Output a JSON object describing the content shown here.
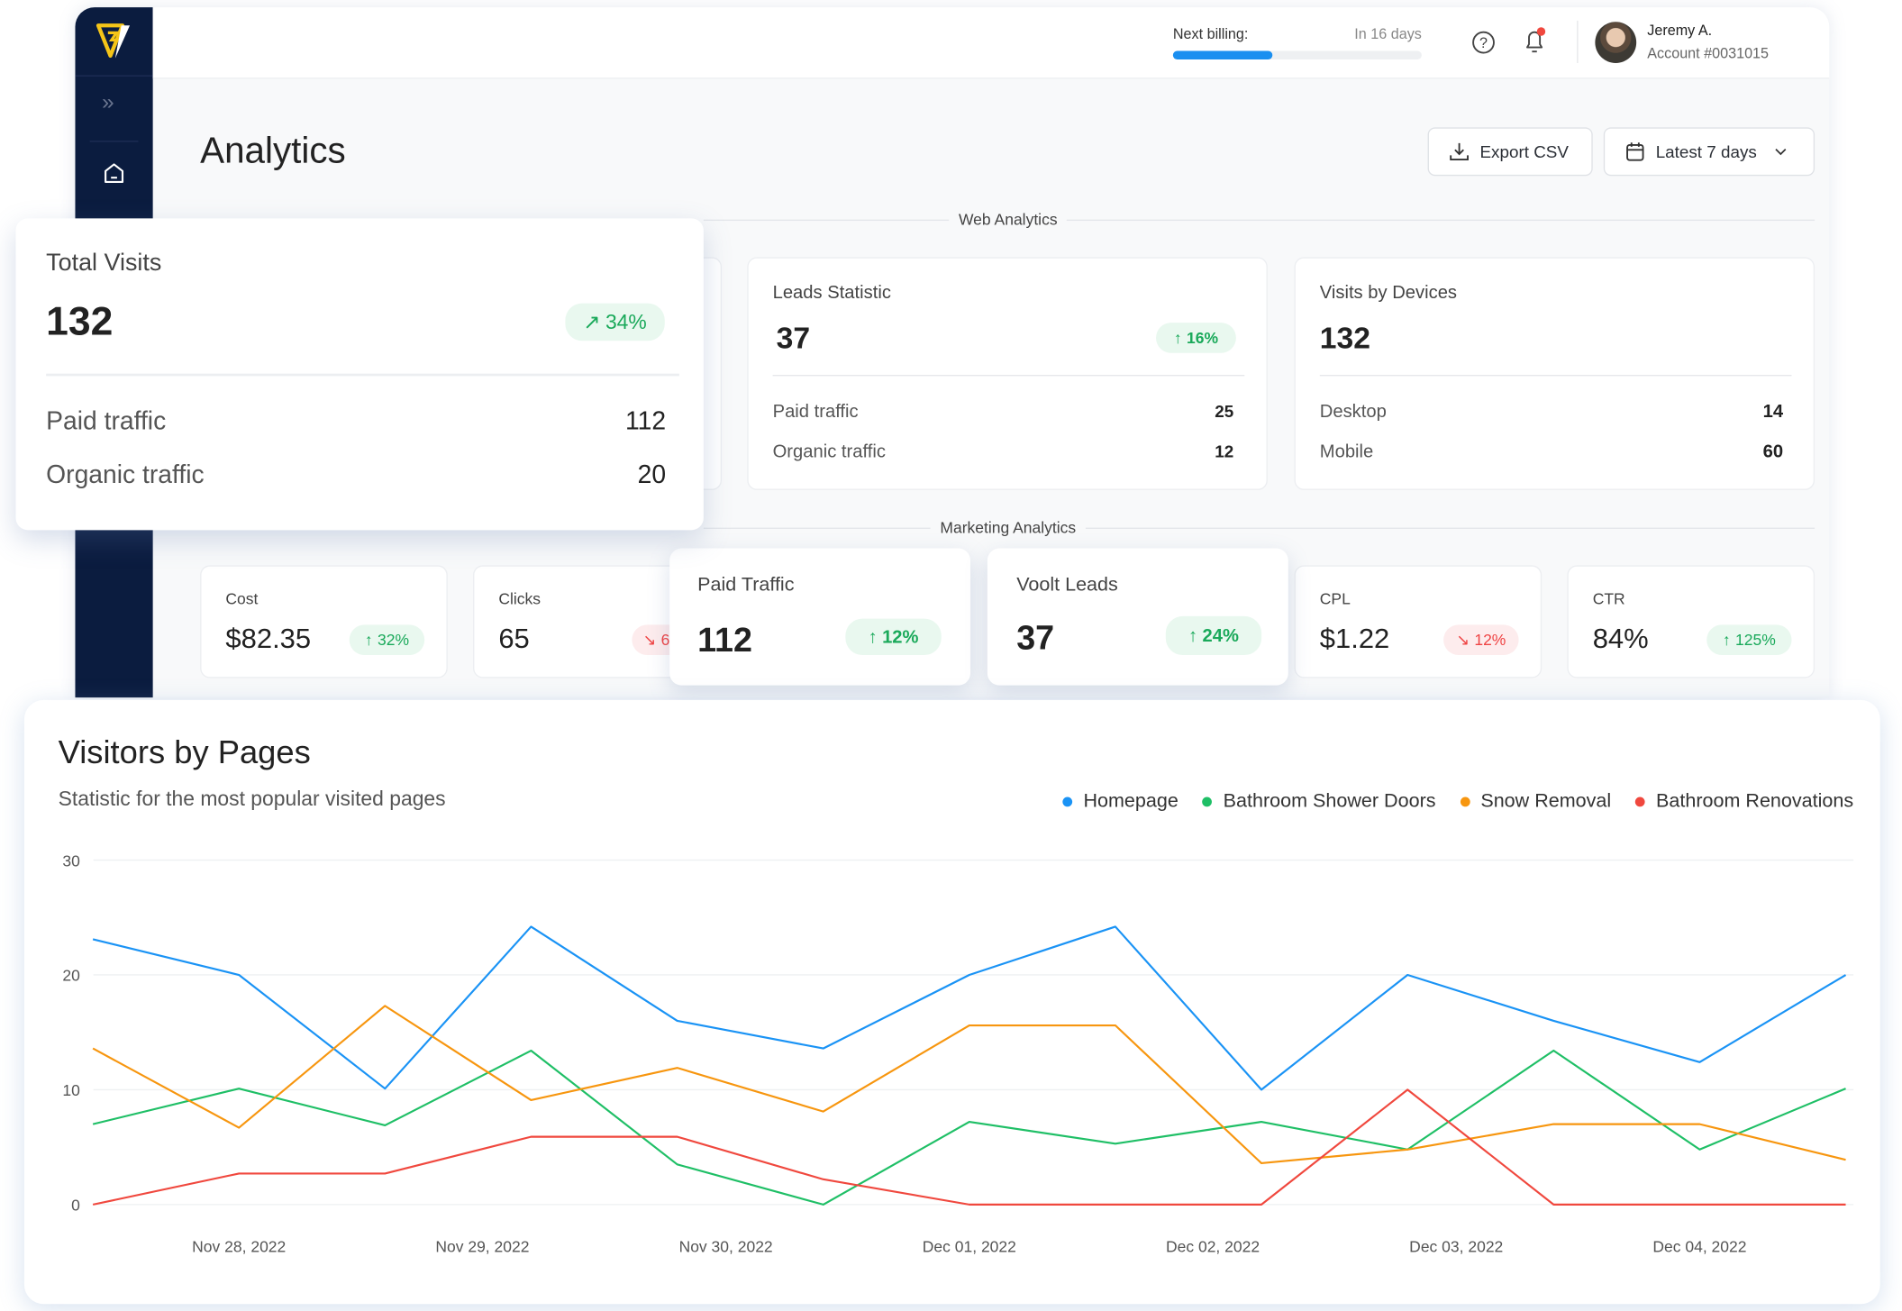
{
  "header": {
    "billing_label": "Next billing:",
    "billing_due": "In 16 days",
    "billing_progress": 0.4,
    "user_name": "Jeremy A.",
    "account": "Account #0031015",
    "notification_dot": true
  },
  "sidebar": {
    "items": [
      {
        "icon": "expand-chevrons-icon"
      },
      {
        "icon": "home-icon"
      }
    ]
  },
  "page": {
    "title": "Analytics",
    "export_label": "Export CSV",
    "range_label": "Latest 7 days"
  },
  "sections": {
    "web": "Web  Analytics",
    "marketing": "Marketing Analytics"
  },
  "total_visits": {
    "title": "Total Visits",
    "value": "132",
    "change": "34%",
    "rows": [
      {
        "label": "Paid traffic",
        "value": "112"
      },
      {
        "label": "Organic traffic",
        "value": "20"
      }
    ]
  },
  "leads": {
    "title": "Leads Statistic",
    "value": "37",
    "change": "16%",
    "rows": [
      {
        "label": "Paid traffic",
        "value": "25"
      },
      {
        "label": "Organic traffic",
        "value": "12"
      }
    ]
  },
  "devices": {
    "title": "Visits by Devices",
    "value": "132",
    "rows": [
      {
        "label": "Desktop",
        "value": "14"
      },
      {
        "label": "Mobile",
        "value": "60"
      }
    ]
  },
  "marketing": [
    {
      "label": "Cost",
      "value": "$82.35",
      "change": "32%",
      "trend": "up"
    },
    {
      "label": "Clicks",
      "value": "65",
      "change": "6",
      "trend": "down"
    },
    {
      "label": "Paid Traffic",
      "value": "112",
      "change": "12%",
      "trend": "up"
    },
    {
      "label": "Voolt Leads",
      "value": "37",
      "change": "24%",
      "trend": "up"
    },
    {
      "label": "CPL",
      "value": "$1.22",
      "change": "12%",
      "trend": "down"
    },
    {
      "label": "CTR",
      "value": "84%",
      "change": "125%",
      "trend": "up"
    }
  ],
  "colors": {
    "navy": "#0b1c3f",
    "up": "#1aa95a",
    "down": "#ef4444",
    "accent": "#1a93f5"
  },
  "chart_data": {
    "type": "line",
    "title": "Visitors by Pages",
    "subtitle": "Statistic for the most popular visited pages",
    "legend": "top-right",
    "grid": true,
    "ylim": [
      0,
      30
    ],
    "y_ticks": [
      "0",
      "10",
      "20",
      "30"
    ],
    "x": [
      "2022-11-27T09:36",
      "2022-11-28T00:00",
      "2022-11-28T14:24",
      "2022-11-29T04:48",
      "2022-11-29T19:12",
      "2022-11-30T09:36",
      "2022-12-01T00:00",
      "2022-12-01T14:24",
      "2022-12-02T04:48",
      "2022-12-02T19:12",
      "2022-12-03T09:36",
      "2022-12-04T00:00",
      "2022-12-04T14:24"
    ],
    "x_ticks": [
      {
        "value": "2022-11-28T00:00",
        "label": "Nov 28, 2022"
      },
      {
        "value": "2022-11-29T00:00",
        "label": "Nov 29, 2022"
      },
      {
        "value": "2022-11-30T00:00",
        "label": "Nov 30, 2022"
      },
      {
        "value": "2022-12-01T00:00",
        "label": "Dec 01, 2022"
      },
      {
        "value": "2022-12-02T00:00",
        "label": "Dec 02, 2022"
      },
      {
        "value": "2022-12-03T00:00",
        "label": "Dec 03, 2022"
      },
      {
        "value": "2022-12-04T00:00",
        "label": "Dec 04, 2022"
      }
    ],
    "series": [
      {
        "name": "Homepage",
        "color": "#1a93f5",
        "values": [
          23.1,
          20,
          10.1,
          24.2,
          16,
          13.6,
          20,
          24.2,
          10,
          20,
          16,
          12.4,
          20
        ]
      },
      {
        "name": "Bathroom Shower Doors",
        "color": "#1fbf66",
        "values": [
          7,
          10.1,
          6.9,
          13.4,
          3.5,
          0,
          7.2,
          5.3,
          7.2,
          4.8,
          13.4,
          4.8,
          10.1
        ]
      },
      {
        "name": "Snow Removal",
        "color": "#f7960f",
        "values": [
          13.6,
          6.7,
          17.3,
          9.1,
          11.9,
          8.1,
          15.6,
          15.6,
          3.6,
          4.8,
          7,
          7,
          3.9
        ]
      },
      {
        "name": "Bathroom Renovations",
        "color": "#f0483e",
        "values": [
          0,
          2.7,
          2.7,
          5.9,
          5.9,
          2.2,
          0,
          0,
          0,
          10,
          0,
          0,
          0
        ]
      }
    ]
  }
}
